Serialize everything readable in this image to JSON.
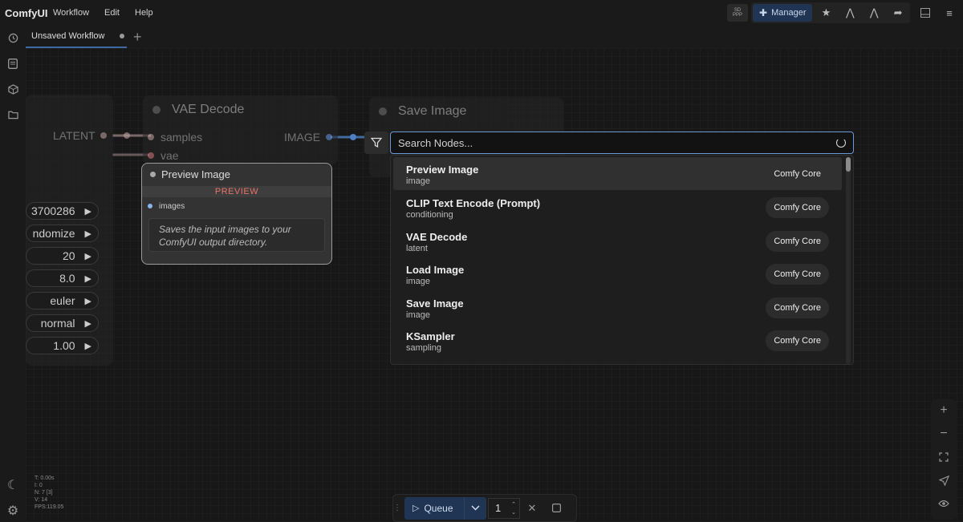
{
  "app": {
    "brand": "ComfyUI"
  },
  "menu": [
    "Workflow",
    "Edit",
    "Help"
  ],
  "topbar": {
    "sd_badge_line1": "SD",
    "sd_badge_line2": "PPP",
    "manager_label": "Manager"
  },
  "tabs": [
    {
      "label": "Unsaved Workflow"
    }
  ],
  "nodes": {
    "left_output": "LATENT",
    "vae_decode": {
      "title": "VAE Decode",
      "inputs": [
        "samples",
        "vae"
      ],
      "output": "IMAGE"
    },
    "save_image": {
      "title": "Save Image"
    },
    "widgets": [
      "3700286",
      "ndomize",
      "20",
      "8.0",
      "euler",
      "normal",
      "1.00"
    ]
  },
  "preview_card": {
    "title": "Preview Image",
    "badge": "PREVIEW",
    "input": "images",
    "description": "Saves the input images to your ComfyUI output directory."
  },
  "search": {
    "placeholder": "Search Nodes...",
    "results": [
      {
        "name": "Preview Image",
        "category": "image",
        "source": "Comfy Core"
      },
      {
        "name": "CLIP Text Encode (Prompt)",
        "category": "conditioning",
        "source": "Comfy Core"
      },
      {
        "name": "VAE Decode",
        "category": "latent",
        "source": "Comfy Core"
      },
      {
        "name": "Load Image",
        "category": "image",
        "source": "Comfy Core"
      },
      {
        "name": "Save Image",
        "category": "image",
        "source": "Comfy Core"
      },
      {
        "name": "KSampler",
        "category": "sampling",
        "source": "Comfy Core"
      }
    ]
  },
  "stats": [
    "T: 0.00s",
    "I: 0",
    "N: 7 [3]",
    "V: 14",
    "FPS:119.05"
  ],
  "queue": {
    "label": "Queue",
    "count": "1"
  },
  "colors": {
    "accent": "#1f3553",
    "focus": "#6a9ad6",
    "badge_red": "#e7726b"
  }
}
